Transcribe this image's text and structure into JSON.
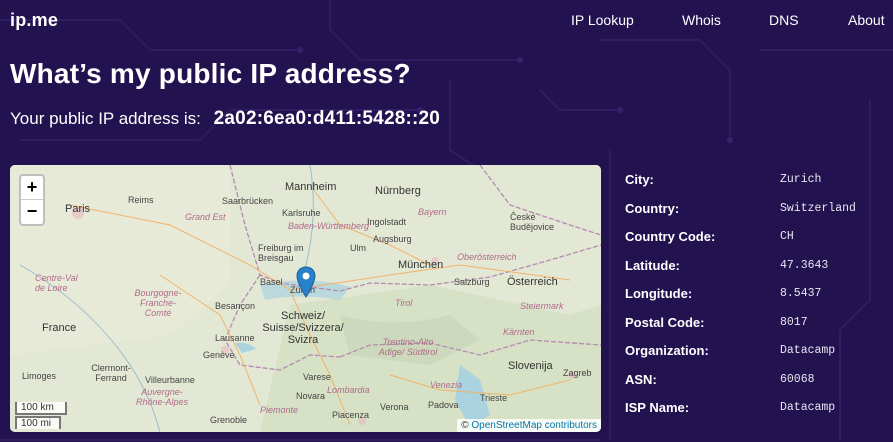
{
  "header": {
    "logo_main": "ip",
    "logo_dot": ".",
    "logo_suffix": "me",
    "nav": [
      "IP Lookup",
      "Whois",
      "DNS",
      "About"
    ]
  },
  "page": {
    "title": "What’s my public IP address?",
    "ip_label": "Your public IP address is:",
    "ip_value": "2a02:6ea0:d411:5428::20"
  },
  "map": {
    "zoom_in": "+",
    "zoom_out": "−",
    "scale_km": "100 km",
    "scale_mi": "100 mi",
    "attribution_prefix": "© ",
    "attribution_link": "OpenStreetMap contributors",
    "labels": [
      "Mannheim",
      "Nürnberg",
      "Paris",
      "Reims",
      "Saarbrücken",
      "Karlsruhe",
      "Ingolstadt",
      "Bayern",
      "České Budějovice",
      "Grand Est",
      "Baden-Württemberg",
      "Ulm",
      "Augsburg",
      "Freiburg im Breisgau",
      "München",
      "Oberösterreich",
      "Centre-Val de Loire",
      "Basel",
      "Zürich",
      "Salzburg",
      "Österreich",
      "Bourgogne-Franche-Comté",
      "Besançon",
      "Schweiz/ Suisse/Svizzera/ Svizra",
      "Tirol",
      "Steiermark",
      "France",
      "Lausanne",
      "Kärnten",
      "Genève",
      "Trentino-Alto Adige/ Südtirol",
      "Slovenija",
      "Limoges",
      "Clermont-Ferrand",
      "Villeurbanne",
      "Auvergne-Rhône-Alpes",
      "Varese",
      "Lombardia",
      "Venezia",
      "Trieste",
      "Zagreb",
      "Grenoble",
      "Novara",
      "Piacenza",
      "Verona",
      "Padova",
      "Piemonte"
    ]
  },
  "info": [
    {
      "key": "City:",
      "value": "Zurich"
    },
    {
      "key": "Country:",
      "value": "Switzerland"
    },
    {
      "key": "Country Code:",
      "value": "CH"
    },
    {
      "key": "Latitude:",
      "value": "47.3643"
    },
    {
      "key": "Longitude:",
      "value": "8.5437"
    },
    {
      "key": "Postal Code:",
      "value": "8017"
    },
    {
      "key": "Organization:",
      "value": "Datacamp"
    },
    {
      "key": "ASN:",
      "value": "60068"
    },
    {
      "key": "ISP Name:",
      "value": "Datacamp"
    }
  ],
  "colors": {
    "background": "#22124f",
    "text": "#ffffff",
    "pin": "#2a81cb",
    "link": "#0078a8"
  }
}
